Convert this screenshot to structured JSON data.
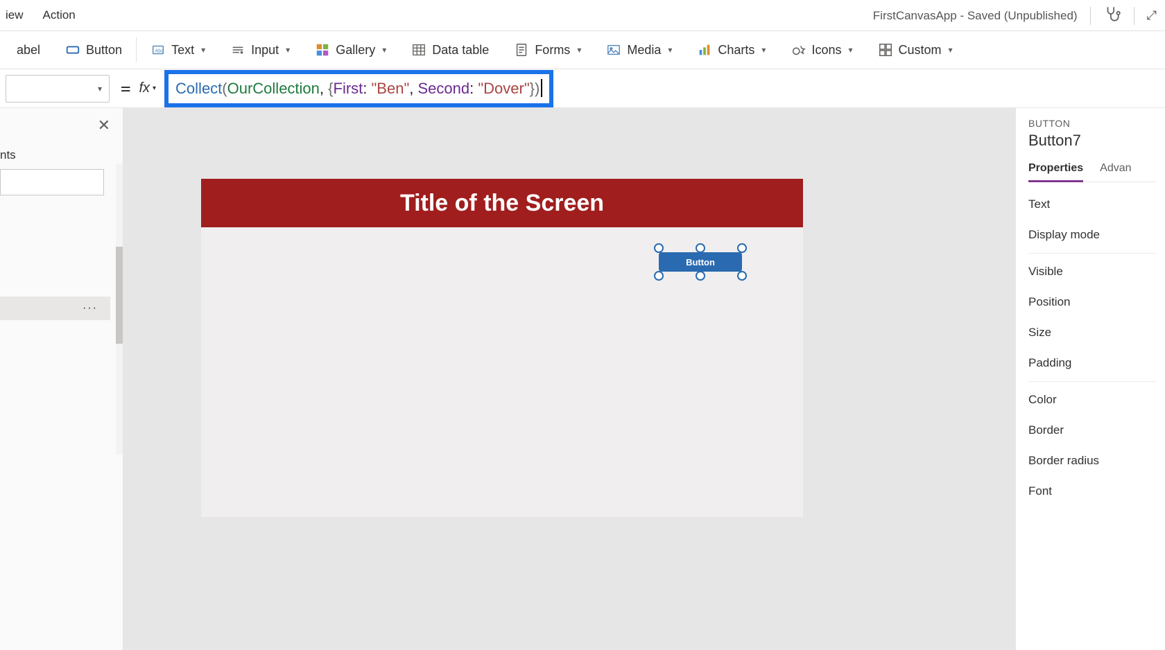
{
  "header": {
    "menus": [
      "iew",
      "Action"
    ],
    "app_name": "FirstCanvasApp - Saved (Unpublished)"
  },
  "ribbon": {
    "label_text": "abel",
    "button_text": "Button",
    "text": "Text",
    "input": "Input",
    "gallery": "Gallery",
    "data_table": "Data table",
    "forms": "Forms",
    "media": "Media",
    "charts": "Charts",
    "icons": "Icons",
    "custom": "Custom"
  },
  "formula_bar": {
    "equals": "=",
    "fx": "fx",
    "tokens": {
      "func": "Collect",
      "lparen": "(",
      "ident": "OurCollection",
      "comma1": ", ",
      "lbrace": "{",
      "key1": "First",
      "colon1": ": ",
      "str1": "\"Ben\"",
      "comma2": ", ",
      "key2": "Second",
      "colon2": ": ",
      "str2": "\"Dover\"",
      "rbrace": "}",
      "rparen": ")"
    }
  },
  "left_panel": {
    "tab_label_partial": "nts",
    "more": "···"
  },
  "canvas": {
    "screen_title": "Title of the Screen",
    "button_text": "Button"
  },
  "right_panel": {
    "control_type": "BUTTON",
    "control_name": "Button7",
    "tabs": {
      "properties": "Properties",
      "advanced": "Advan"
    },
    "props": [
      "Text",
      "Display mode",
      "Visible",
      "Position",
      "Size",
      "Padding",
      "Color",
      "Border",
      "Border radius",
      "Font"
    ]
  }
}
